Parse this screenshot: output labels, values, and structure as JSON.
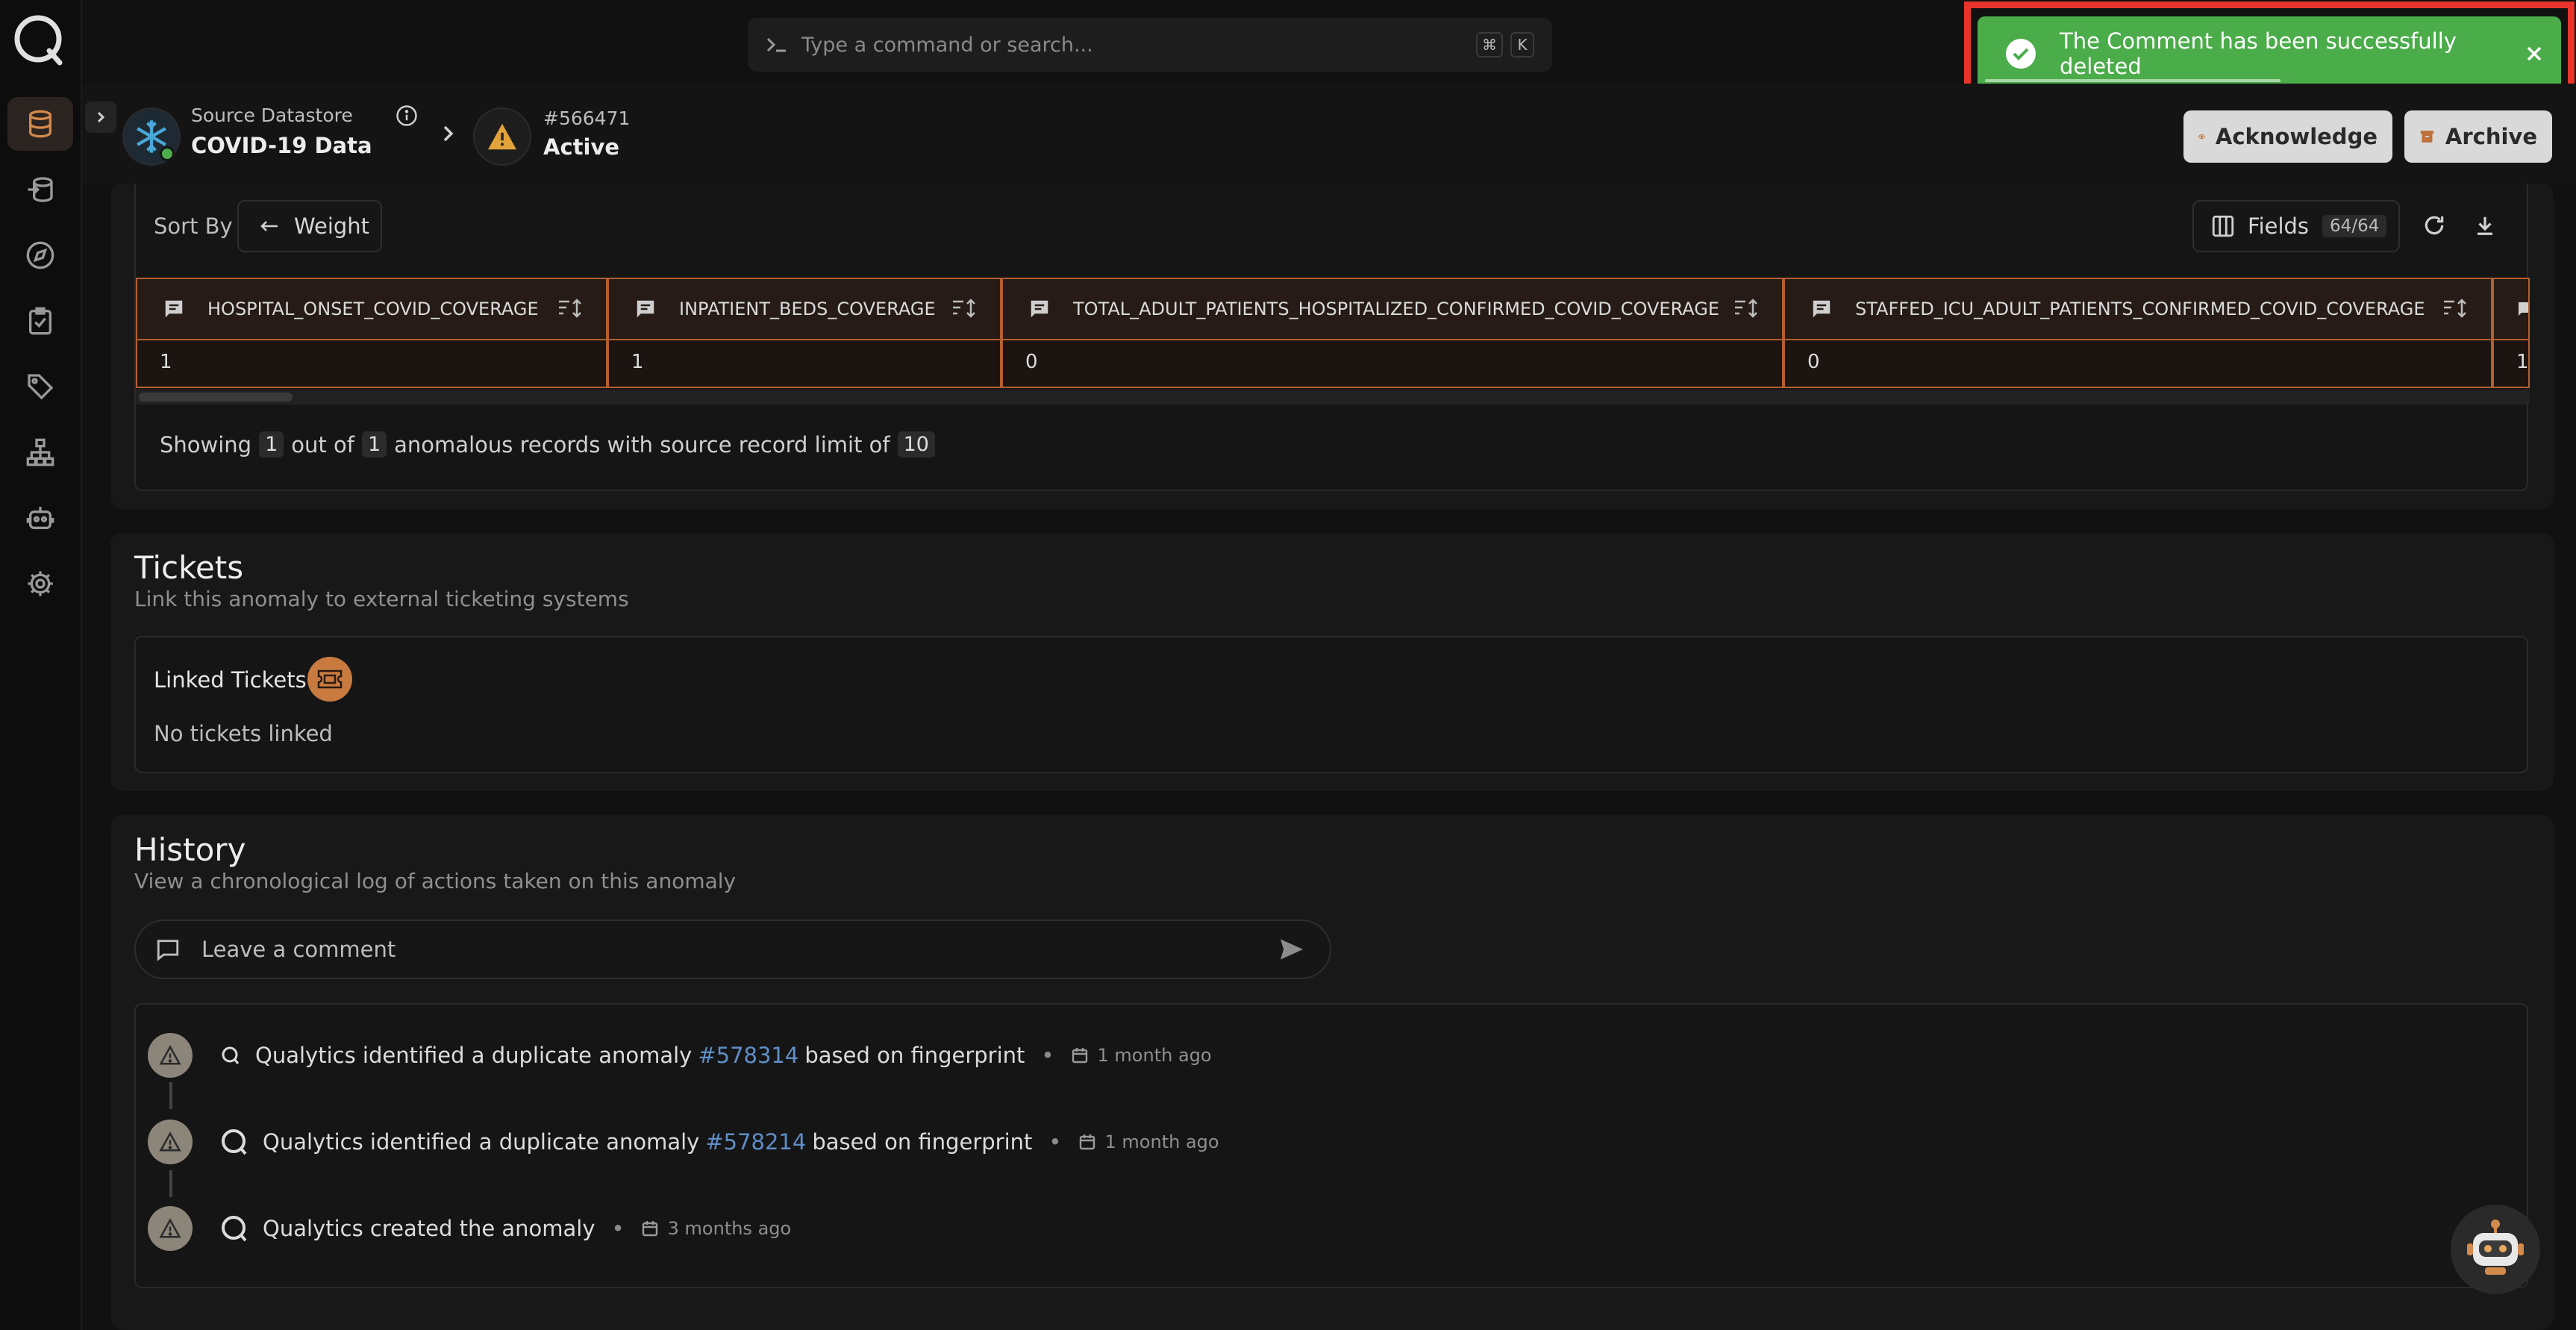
{
  "command_bar": {
    "placeholder": "Type a command or search...",
    "shortcut_mod": "⌘",
    "shortcut_key": "K"
  },
  "toast": {
    "message": "The Comment has been successfully deleted",
    "status": "success"
  },
  "header": {
    "datastore_label": "Source Datastore",
    "datastore_name": "COVID-19 Data",
    "anomaly_id": "#566471",
    "anomaly_status": "Active",
    "acknowledge_label": "Acknowledge",
    "archive_label": "Archive"
  },
  "records": {
    "sort_label": "Sort By",
    "sort_value": "Weight",
    "fields_label": "Fields",
    "fields_count": "64/64",
    "columns": [
      "HOSPITAL_ONSET_COVID_COVERAGE",
      "INPATIENT_BEDS_COVERAGE",
      "TOTAL_ADULT_PATIENTS_HOSPITALIZED_CONFIRMED_COVID_COVERAGE",
      "STAFFED_ICU_ADULT_PATIENTS_CONFIRMED_COVID_COVERAGE"
    ],
    "row": [
      "1",
      "1",
      "0",
      "0",
      "1"
    ],
    "showing_prefix": "Showing",
    "showing_count": "1",
    "showing_mid": "out of",
    "showing_total": "1",
    "showing_suffix": "anomalous records with source record limit of",
    "record_limit": "10"
  },
  "tickets": {
    "title": "Tickets",
    "subtitle": "Link this anomaly to external ticketing systems",
    "linked_label": "Linked Tickets",
    "empty_text": "No tickets linked"
  },
  "history": {
    "title": "History",
    "subtitle": "View a chronological log of actions taken on this anomaly",
    "comment_placeholder": "Leave a comment",
    "entries": [
      {
        "text_before": "Qualytics identified a duplicate anomaly",
        "link": "#578314",
        "text_after": "based on fingerprint",
        "time": "1 month ago"
      },
      {
        "text_before": "Qualytics identified a duplicate anomaly",
        "link": "#578214",
        "text_after": "based on fingerprint",
        "time": "1 month ago"
      },
      {
        "text_before": "Qualytics created the anomaly",
        "time": "3 months ago"
      }
    ]
  },
  "colors": {
    "accent": "#c87a3f",
    "success": "#4bac4a",
    "link": "#5f8ec7",
    "highlight": "#e8342b"
  }
}
